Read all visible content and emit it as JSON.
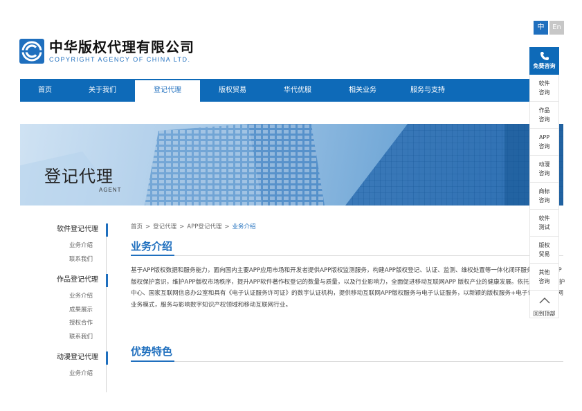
{
  "lang": {
    "zh": "中",
    "en": "En"
  },
  "brand": {
    "name_cn": "中华版权代理有限公司",
    "name_en": "COPYRIGHT AGENCY OF CHINA LTD.",
    "color": "#1f6fbe"
  },
  "nav": {
    "items": [
      {
        "label": "首页"
      },
      {
        "label": "关于我们"
      },
      {
        "label": "登记代理",
        "active": true
      },
      {
        "label": "版权贸易"
      },
      {
        "label": "华代优服"
      },
      {
        "label": "相关业务"
      },
      {
        "label": "服务与支持"
      }
    ]
  },
  "banner": {
    "title": "登记代理",
    "subtitle": "AGENT"
  },
  "sidebar": {
    "groups": [
      {
        "title": "软件登记代理",
        "items": [
          "业务介绍",
          "联系我们"
        ]
      },
      {
        "title": "作品登记代理",
        "items": [
          "业务介绍",
          "成果展示",
          "授权合作",
          "联系我们"
        ]
      },
      {
        "title": "动漫登记代理",
        "items": [
          "业务介绍"
        ]
      }
    ]
  },
  "breadcrumb": {
    "items": [
      "首页",
      "登记代理",
      "APP登记代理"
    ],
    "separator": ">",
    "current": "业务介绍"
  },
  "content": {
    "section1_title": "业务介绍",
    "body": "基于APP版权数据和服务能力，面向国内主要APP应用市场和开发者提供APP版权监测服务，构建APP版权登记、认证、监测、维权处置等一体化闭环服务，增进APP版权保护意识，维护APP版权市场秩序，提升APP软件著作权登记的数量与质量，以及行业影响力，全面促进移动互联网APP 版权产业的健康发展。依托中国版权保护中心、国家互联网信息办公室和具有《电子认证服务许可证》的数字认证机构，提供移动互联网APP版权服务与电子认证服务，以新颖的版权服务+电子认证的互联网业务模式，服务与影响数字知识产权领域和移动互联网行业。",
    "section2_title": "优势特色"
  },
  "float_bar": {
    "head_label": "免费咨询",
    "items": [
      [
        "软件",
        "咨询"
      ],
      [
        "作品",
        "咨询"
      ],
      [
        "APP",
        "咨询"
      ],
      [
        "动漫",
        "咨询"
      ],
      [
        "商标",
        "咨询"
      ],
      [
        "软件",
        "测试"
      ],
      [
        "版权",
        "贸易"
      ],
      [
        "其他",
        "咨询"
      ]
    ],
    "top_label": "回到顶部"
  }
}
